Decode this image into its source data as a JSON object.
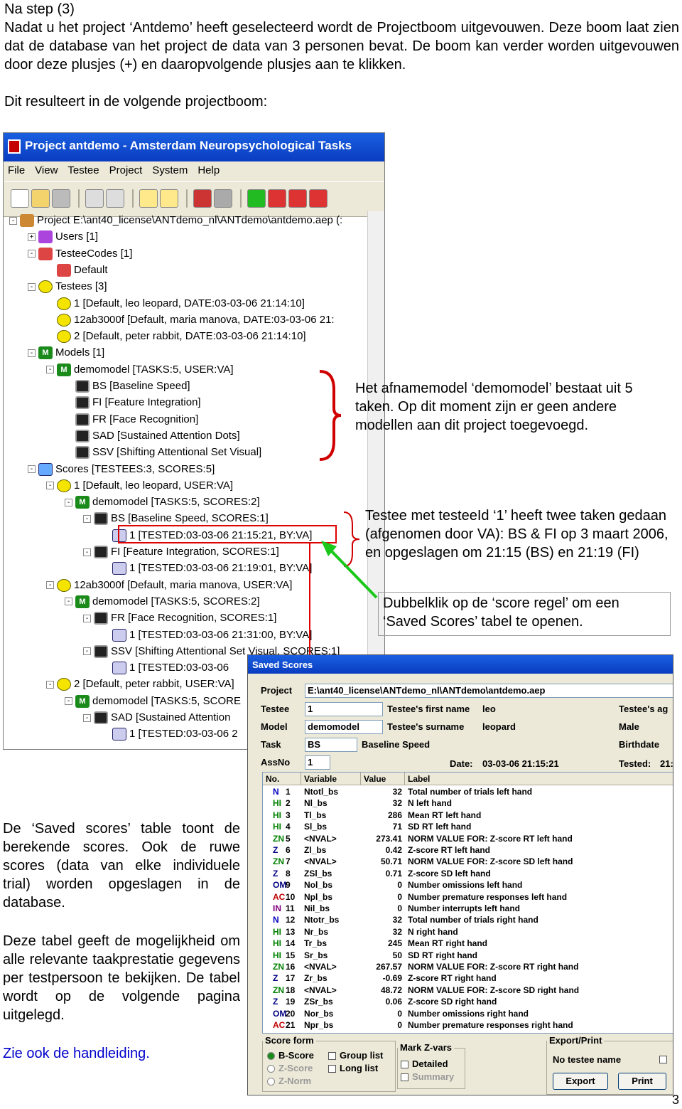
{
  "intro": {
    "line1": "Na step (3)",
    "para": "Nadat u het project ‘Antdemo’ heeft geselecteerd wordt de Projectboom uitgevouwen. Deze boom laat zien dat de database van het project de data van 3 personen bevat. De boom kan verder worden uitgevouwen door deze plusjes (+) en daaropvolgende plusjes aan te klikken.",
    "result": "Dit resulteert in de volgende projectboom:"
  },
  "app": {
    "title": "Project antdemo - Amsterdam Neuropsychological Tasks",
    "menu": [
      "File",
      "View",
      "Testee",
      "Project",
      "System",
      "Help"
    ],
    "toolbar_icons": [
      "new-icon",
      "open-icon",
      "save-icon",
      "print-icon",
      "preview-icon",
      "help-icon",
      "context-help-icon",
      "book-icon",
      "cfr-icon",
      "smiley-icon",
      "testee-icon",
      "testees-icon",
      "settings-icon"
    ],
    "tree": [
      {
        "pm": "-",
        "icon": "book",
        "text": "Project E:\\ant40_license\\ANTdemo_nl\\ANTdemo\\antdemo.aep (:"
      },
      {
        "pm": "+",
        "icon": "users",
        "text": "Users [1]"
      },
      {
        "pm": "-",
        "icon": "codes",
        "text": "TesteeCodes [1]"
      },
      {
        "pm": "",
        "icon": "pen",
        "text": "Default"
      },
      {
        "pm": "-",
        "icon": "smiles",
        "text": "Testees [3]"
      },
      {
        "pm": "",
        "icon": "smile",
        "text": "1 [Default, leo leopard, DATE:03-03-06 21:14:10]"
      },
      {
        "pm": "",
        "icon": "smile",
        "text": "12ab3000f [Default, maria manova, DATE:03-03-06 21:"
      },
      {
        "pm": "",
        "icon": "smile",
        "text": "2 [Default, peter rabbit, DATE:03-03-06 21:14:10]"
      },
      {
        "pm": "-",
        "icon": "models",
        "text": "Models [1]"
      },
      {
        "pm": "-",
        "icon": "model",
        "text": "demomodel [TASKS:5, USER:VA]"
      },
      {
        "pm": "",
        "icon": "task",
        "text": "BS [Baseline Speed]"
      },
      {
        "pm": "",
        "icon": "task",
        "text": "FI [Feature Integration]"
      },
      {
        "pm": "",
        "icon": "task",
        "text": "FR [Face Recognition]"
      },
      {
        "pm": "",
        "icon": "task",
        "text": "SAD [Sustained Attention Dots]"
      },
      {
        "pm": "",
        "icon": "task",
        "text": "SSV [Shifting Attentional Set Visual]"
      },
      {
        "pm": "-",
        "icon": "scores",
        "text": "Scores [TESTEES:3, SCORES:5]"
      },
      {
        "pm": "-",
        "icon": "smile",
        "text": "1 [Default, leo leopard, USER:VA]"
      },
      {
        "pm": "-",
        "icon": "model",
        "text": "demomodel [TASKS:5, SCORES:2]"
      },
      {
        "pm": "-",
        "icon": "task",
        "text": "BS [Baseline Speed, SCORES:1]"
      },
      {
        "pm": "",
        "icon": "score",
        "text": "1 [TESTED:03-03-06 21:15:21, BY:VA]"
      },
      {
        "pm": "-",
        "icon": "task",
        "text": "FI [Feature Integration, SCORES:1]"
      },
      {
        "pm": "",
        "icon": "score",
        "text": "1 [TESTED:03-03-06 21:19:01, BY:VA]"
      },
      {
        "pm": "-",
        "icon": "smile",
        "text": "12ab3000f [Default, maria manova, USER:VA]"
      },
      {
        "pm": "-",
        "icon": "model",
        "text": "demomodel [TASKS:5, SCORES:2]"
      },
      {
        "pm": "-",
        "icon": "task",
        "text": "FR [Face Recognition, SCORES:1]"
      },
      {
        "pm": "",
        "icon": "score",
        "text": "1 [TESTED:03-03-06 21:31:00, BY:VA]"
      },
      {
        "pm": "-",
        "icon": "task",
        "text": "SSV [Shifting Attentional Set Visual, SCORES:1]"
      },
      {
        "pm": "",
        "icon": "score",
        "text": "1 [TESTED:03-03-06"
      },
      {
        "pm": "-",
        "icon": "smile",
        "text": "2 [Default, peter rabbit, USER:VA]"
      },
      {
        "pm": "-",
        "icon": "model",
        "text": "demomodel [TASKS:5, SCORE"
      },
      {
        "pm": "-",
        "icon": "task",
        "text": "SAD [Sustained Attention"
      },
      {
        "pm": "",
        "icon": "score",
        "text": "1 [TESTED:03-03-06 2"
      }
    ]
  },
  "annotations": {
    "model": "Het afnamemodel ‘demomodel’ bestaat uit 5 taken. Op dit moment zijn er geen andere modellen aan dit project toegevoegd.",
    "testee": "Testee met testeeId ‘1’ heeft twee taken gedaan (afgenomen door VA): BS & FI op 3 maart 2006, en opgeslagen om 21:15 (BS) en 21:19 (FI)",
    "dblclick": "Dubbelklik op de ‘score regel’ om een ‘Saved Scores’ tabel te openen."
  },
  "saved_scores": {
    "title": "Saved Scores",
    "project_label": "Project",
    "project_value": "E:\\ant40_license\\ANTdemo_nl\\ANTdemo\\antdemo.aep",
    "testee_label": "Testee",
    "testee_value": "1",
    "model_label": "Model",
    "model_value": "demomodel",
    "task_label": "Task",
    "task_value": "BS",
    "task_name": "Baseline Speed",
    "assno_label": "AssNo",
    "assno_value": "1",
    "first_name_label": "Testee's first name",
    "first_name": "leo",
    "surname_label": "Testee's surname",
    "surname": "leopard",
    "age_label": "Testee's ag",
    "sex": "Male",
    "birthdate_label": "Birthdate",
    "date_label": "Date:",
    "date_value": "03-03-06 21:15:21",
    "tested_label": "Tested:",
    "tested_value": "21:",
    "columns": [
      "No.",
      "Variable",
      "Value",
      "Label"
    ],
    "rows": [
      {
        "tag": "N",
        "tc": "#0000c0",
        "no": "1",
        "var": "Ntotl_bs",
        "val": "32",
        "label": "Total number of trials left hand"
      },
      {
        "tag": "HI",
        "tc": "#008000",
        "no": "2",
        "var": "Nl_bs",
        "val": "32",
        "label": "N left hand"
      },
      {
        "tag": "HI",
        "tc": "#008000",
        "no": "3",
        "var": "Tl_bs",
        "val": "286",
        "label": "Mean RT left hand"
      },
      {
        "tag": "HI",
        "tc": "#008000",
        "no": "4",
        "var": "Sl_bs",
        "val": "71",
        "label": "SD RT left hand"
      },
      {
        "tag": "ZN",
        "tc": "#008000",
        "no": "5",
        "var": "<NVAL>",
        "val": "273.41",
        "label": "NORM VALUE FOR: Z-score RT left hand"
      },
      {
        "tag": "Z",
        "tc": "#000080",
        "no": "6",
        "var": "Zl_bs",
        "val": "0.42",
        "label": "Z-score RT left hand"
      },
      {
        "tag": "ZN",
        "tc": "#008000",
        "no": "7",
        "var": "<NVAL>",
        "val": "50.71",
        "label": "NORM VALUE FOR: Z-score SD left hand"
      },
      {
        "tag": "Z",
        "tc": "#000080",
        "no": "8",
        "var": "ZSl_bs",
        "val": "0.71",
        "label": "Z-score SD left hand"
      },
      {
        "tag": "OM",
        "tc": "#000080",
        "no": "9",
        "var": "Nol_bs",
        "val": "0",
        "label": "Number omissions left hand"
      },
      {
        "tag": "AC",
        "tc": "#c00000",
        "no": "10",
        "var": "Npl_bs",
        "val": "0",
        "label": "Number premature responses left hand"
      },
      {
        "tag": "IN",
        "tc": "#800080",
        "no": "11",
        "var": "Nil_bs",
        "val": "0",
        "label": "Number interrupts left hand"
      },
      {
        "tag": "N",
        "tc": "#0000c0",
        "no": "12",
        "var": "Ntotr_bs",
        "val": "32",
        "label": "Total number of trials right hand"
      },
      {
        "tag": "HI",
        "tc": "#008000",
        "no": "13",
        "var": "Nr_bs",
        "val": "32",
        "label": "N right hand"
      },
      {
        "tag": "HI",
        "tc": "#008000",
        "no": "14",
        "var": "Tr_bs",
        "val": "245",
        "label": "Mean RT right hand"
      },
      {
        "tag": "HI",
        "tc": "#008000",
        "no": "15",
        "var": "Sr_bs",
        "val": "50",
        "label": "SD RT right hand"
      },
      {
        "tag": "ZN",
        "tc": "#008000",
        "no": "16",
        "var": "<NVAL>",
        "val": "267.57",
        "label": "NORM VALUE FOR: Z-score RT right hand"
      },
      {
        "tag": "Z",
        "tc": "#000080",
        "no": "17",
        "var": "Zr_bs",
        "val": "-0.69",
        "label": "Z-score RT right hand"
      },
      {
        "tag": "ZN",
        "tc": "#008000",
        "no": "18",
        "var": "<NVAL>",
        "val": "48.72",
        "label": "NORM VALUE FOR: Z-score SD right hand"
      },
      {
        "tag": "Z",
        "tc": "#000080",
        "no": "19",
        "var": "ZSr_bs",
        "val": "0.06",
        "label": "Z-score SD right hand"
      },
      {
        "tag": "OM",
        "tc": "#000080",
        "no": "20",
        "var": "Nor_bs",
        "val": "0",
        "label": "Number omissions right hand"
      },
      {
        "tag": "AC",
        "tc": "#c00000",
        "no": "21",
        "var": "Npr_bs",
        "val": "0",
        "label": "Number premature responses right hand"
      }
    ],
    "score_form_title": "Score form",
    "bscore": "B-Score",
    "zscore": "Z-Score",
    "znorm": "Z-Norm",
    "group_list": "Group list",
    "long_list": "Long list",
    "mark_title": "Mark Z-vars",
    "detailed": "Detailed",
    "summary": "Summary",
    "export_title": "Export/Print",
    "no_testee": "No testee name",
    "export_btn": "Export",
    "print_btn": "Print"
  },
  "bottom": {
    "p1": "De ‘Saved scores’ table toont de berekende scores. Ook de ruwe scores (data van elke individuele trial) worden opgeslagen in de database.",
    "p2": "Deze tabel geeft de mogelijkheid om alle relevante taakprestatie gegevens per testpersoon te bekijken. De tabel wordt op de volgende pagina uitgelegd.",
    "link": "Zie ook de handleiding."
  },
  "page_number": "3"
}
